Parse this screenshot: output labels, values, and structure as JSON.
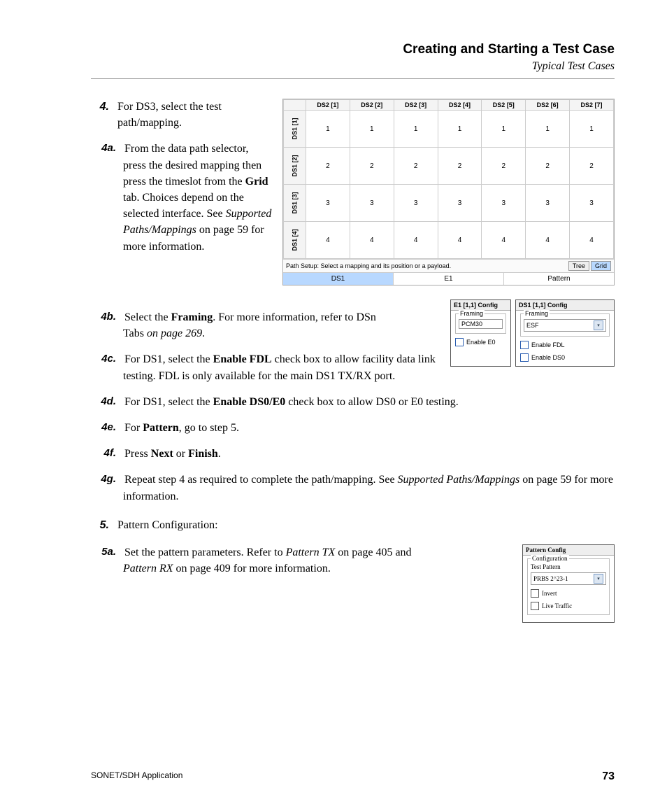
{
  "header": {
    "title": "Creating and Starting a Test Case",
    "subtitle": "Typical Test Cases"
  },
  "step4": {
    "num": "4.",
    "intro": "For DS3, select the test path/mapping.",
    "a": {
      "num": "4a.",
      "t1": "From the data path selector, press the desired mapping then press the timeslot from the ",
      "bold1": "Grid",
      "t2": " tab. Choices depend on the selected interface. See ",
      "it1": "Supported Paths/Mappings",
      "t3": " on page 59 for more information."
    },
    "b": {
      "num": "4b.",
      "t1": "Select the ",
      "bold1": "Framing",
      "t2": ". For more information, refer to DSn Tabs ",
      "it1": "on page 269",
      "t3": "."
    },
    "c": {
      "num": "4c.",
      "t1": "For DS1, select the ",
      "bold1": "Enable FDL",
      "t2": " check box to allow facility data link testing. FDL is only available for the main DS1 TX/RX port."
    },
    "d": {
      "num": "4d.",
      "t1": "For DS1, select the ",
      "bold1": "Enable DS0/E0",
      "t2": " check box to allow DS0 or E0 testing."
    },
    "e": {
      "num": "4e.",
      "t1": "For ",
      "bold1": "Pattern",
      "t2": ", go to step 5."
    },
    "f": {
      "num": "4f.",
      "t1": "Press ",
      "bold1": "Next",
      "t2": " or ",
      "bold2": "Finish",
      "t3": "."
    },
    "g": {
      "num": "4g.",
      "t1": "Repeat step 4 as required to complete the path/mapping. See ",
      "it1": "Supported Paths/Mappings",
      "t2": " on page 59 for more information."
    }
  },
  "step5": {
    "num": "5.",
    "intro": "Pattern Configuration:",
    "a": {
      "num": "5a.",
      "t1": "Set the pattern parameters. Refer to ",
      "it1": "Pattern TX",
      "t2": " on page 405 and ",
      "it2": "Pattern RX",
      "t3": " on page 409 for more information."
    }
  },
  "grid": {
    "cols": [
      "DS2 [1]",
      "DS2 [2]",
      "DS2 [3]",
      "DS2 [4]",
      "DS2 [5]",
      "DS2 [6]",
      "DS2 [7]"
    ],
    "rows": [
      "DS1 [1]",
      "DS1 [2]",
      "DS1 [3]",
      "DS1 [4]"
    ],
    "cells": [
      [
        "1",
        "1",
        "1",
        "1",
        "1",
        "1",
        "1"
      ],
      [
        "2",
        "2",
        "2",
        "2",
        "2",
        "2",
        "2"
      ],
      [
        "3",
        "3",
        "3",
        "3",
        "3",
        "3",
        "3"
      ],
      [
        "4",
        "4",
        "4",
        "4",
        "4",
        "4",
        "4"
      ]
    ],
    "footer_text": "Path Setup: Select a mapping and its position or a payload.",
    "btn_tree": "Tree",
    "btn_grid": "Grid",
    "tab_ds1": "DS1",
    "tab_e1": "E1",
    "tab_pattern": "Pattern"
  },
  "e1panel": {
    "title": "E1  [1,1] Config",
    "framing_label": "Framing",
    "framing_value": "PCM30",
    "chk": "Enable E0"
  },
  "ds1panel": {
    "title": "DS1  [1,1] Config",
    "framing_label": "Framing",
    "framing_value": "ESF",
    "chk1": "Enable FDL",
    "chk2": "Enable DS0"
  },
  "patternpanel": {
    "title": "Pattern Config",
    "config_label": "Configuration",
    "tp_label": "Test Pattern",
    "tp_value": "PRBS 2^23-1",
    "chk1": "Invert",
    "chk2": "Live Traffic"
  },
  "footer": {
    "left": "SONET/SDH Application",
    "page": "73"
  }
}
